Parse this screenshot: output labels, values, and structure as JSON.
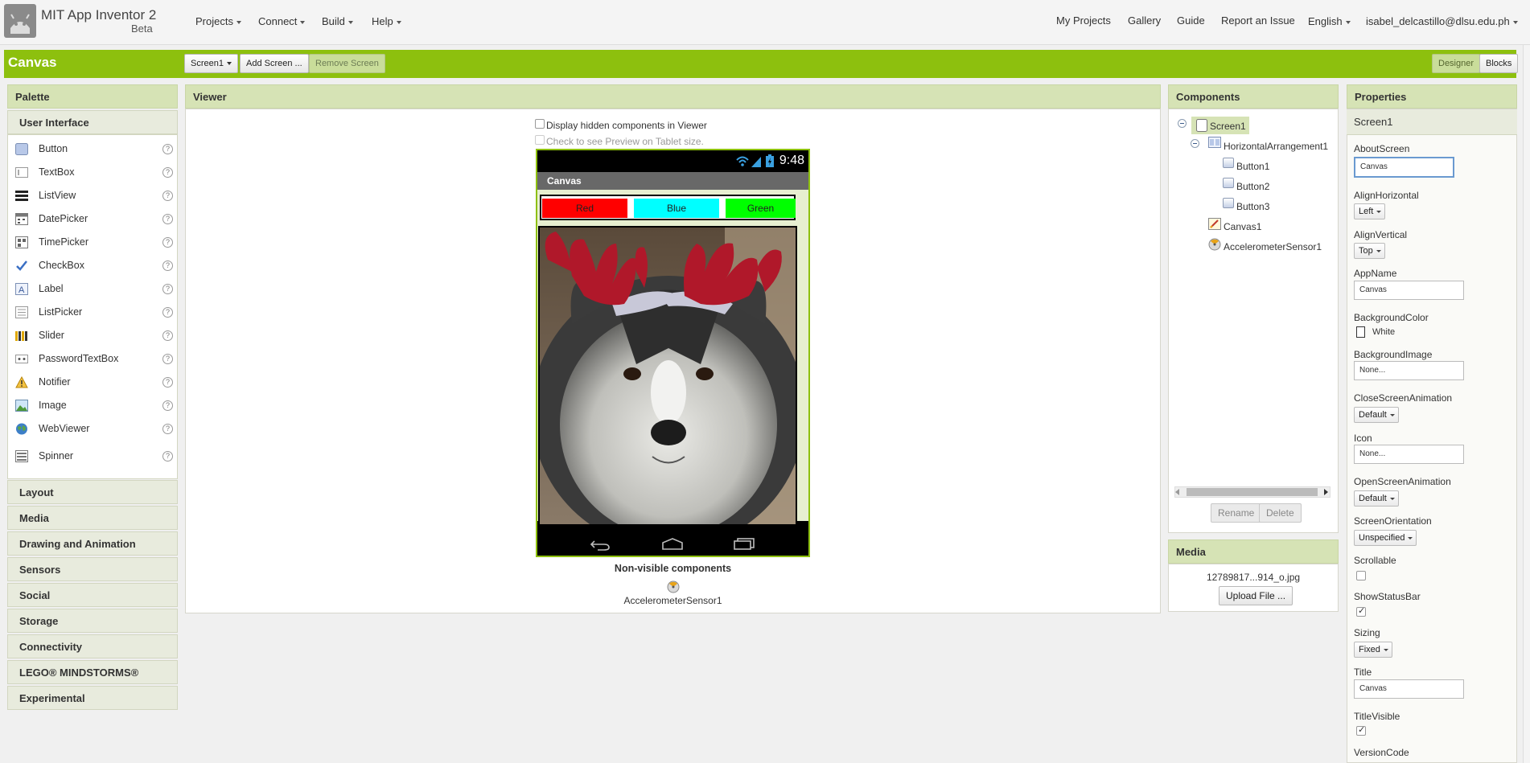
{
  "app": {
    "title": "MIT App Inventor 2",
    "subtitle": "Beta"
  },
  "topnav": {
    "left": [
      "Projects",
      "Connect",
      "Build",
      "Help"
    ],
    "right": {
      "my_projects": "My Projects",
      "gallery": "Gallery",
      "guide": "Guide",
      "report": "Report an Issue",
      "language": "English",
      "user": "isabel_delcastillo@dlsu.edu.ph"
    }
  },
  "project": {
    "name": "Canvas",
    "screen_select": "Screen1",
    "add_screen": "Add Screen ...",
    "remove_screen": "Remove Screen",
    "designer": "Designer",
    "blocks": "Blocks"
  },
  "palette": {
    "title": "Palette",
    "user_interface": "User Interface",
    "items": [
      {
        "label": "Button",
        "icon": "button-icon"
      },
      {
        "label": "TextBox",
        "icon": "textbox-icon"
      },
      {
        "label": "ListView",
        "icon": "listview-icon"
      },
      {
        "label": "DatePicker",
        "icon": "datepicker-icon"
      },
      {
        "label": "TimePicker",
        "icon": "timepicker-icon"
      },
      {
        "label": "CheckBox",
        "icon": "checkbox-icon"
      },
      {
        "label": "Label",
        "icon": "label-icon"
      },
      {
        "label": "ListPicker",
        "icon": "listpicker-icon"
      },
      {
        "label": "Slider",
        "icon": "slider-icon"
      },
      {
        "label": "PasswordTextBox",
        "icon": "passwordtextbox-icon"
      },
      {
        "label": "Notifier",
        "icon": "notifier-icon"
      },
      {
        "label": "Image",
        "icon": "image-icon"
      },
      {
        "label": "WebViewer",
        "icon": "webviewer-icon"
      },
      {
        "label": "Spinner",
        "icon": "spinner-icon"
      }
    ],
    "help_glyph": "?",
    "sections": [
      "Layout",
      "Media",
      "Drawing and Animation",
      "Sensors",
      "Social",
      "Storage",
      "Connectivity",
      "LEGO® MINDSTORMS®",
      "Experimental"
    ]
  },
  "viewer": {
    "title": "Viewer",
    "display_hidden": "Display hidden components in Viewer",
    "tablet_preview": "Check to see Preview on Tablet size.",
    "phone": {
      "time": "9:48",
      "screen_title": "Canvas",
      "buttons": [
        {
          "label": "Red",
          "color": "#ff0000"
        },
        {
          "label": "Blue",
          "color": "#00ffff"
        },
        {
          "label": "Green",
          "color": "#00ff00"
        }
      ]
    },
    "nonvisible_title": "Non-visible components",
    "nonvisible_item": "AccelerometerSensor1"
  },
  "components": {
    "title": "Components",
    "tree": {
      "screen": "Screen1",
      "harr": "HorizontalArrangement1",
      "b1": "Button1",
      "b2": "Button2",
      "b3": "Button3",
      "canvas": "Canvas1",
      "accel": "AccelerometerSensor1"
    },
    "rename": "Rename",
    "delete": "Delete"
  },
  "media": {
    "title": "Media",
    "file": "12789817...914_o.jpg",
    "upload": "Upload File ..."
  },
  "properties": {
    "title": "Properties",
    "component": "Screen1",
    "about_label": "AboutScreen",
    "about_value": "Canvas",
    "alignh_label": "AlignHorizontal",
    "alignh_value": "Left",
    "alignv_label": "AlignVertical",
    "alignv_value": "Top",
    "appname_label": "AppName",
    "appname_value": "Canvas",
    "bgcolor_label": "BackgroundColor",
    "bgcolor_value": "White",
    "bgimage_label": "BackgroundImage",
    "bgimage_value": "None...",
    "closeanim_label": "CloseScreenAnimation",
    "closeanim_value": "Default",
    "icon_label": "Icon",
    "icon_value": "None...",
    "openanim_label": "OpenScreenAnimation",
    "openanim_value": "Default",
    "orient_label": "ScreenOrientation",
    "orient_value": "Unspecified",
    "scrollable_label": "Scrollable",
    "scrollable_checked": false,
    "statusbar_label": "ShowStatusBar",
    "statusbar_checked": true,
    "sizing_label": "Sizing",
    "sizing_value": "Fixed",
    "title_label": "Title",
    "title_value": "Canvas",
    "titlevisible_label": "TitleVisible",
    "titlevisible_checked": true,
    "versioncode_label": "VersionCode"
  },
  "colors": {
    "brand_green": "#8dc00e",
    "panel_header": "#d6e3b5"
  }
}
